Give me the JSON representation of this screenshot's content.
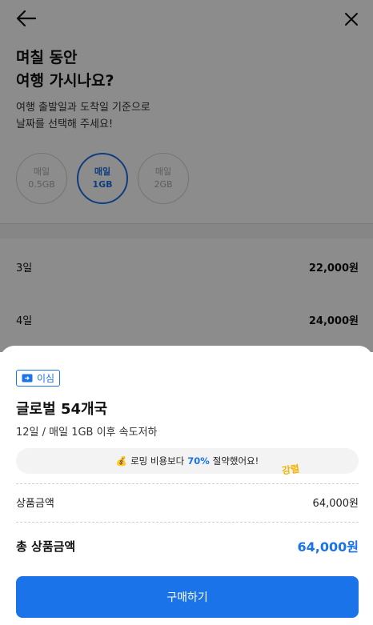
{
  "header": {
    "back_icon": "arrow-left-icon",
    "close_icon": "close-icon"
  },
  "question": {
    "title_line1": "며칠 동안",
    "title_line2": "여행 가시나요?",
    "desc_line1": "여행 출발일과 도착일 기준으로",
    "desc_line2": "날짜를 선택해 주세요!"
  },
  "plans": [
    {
      "line1": "매일",
      "line2": "0.5GB",
      "selected": false
    },
    {
      "line1": "매일",
      "line2": "1GB",
      "selected": true
    },
    {
      "line1": "매일",
      "line2": "2GB",
      "selected": false
    }
  ],
  "days": [
    {
      "label": "3일",
      "price": "22,000원"
    },
    {
      "label": "4일",
      "price": "24,000원"
    }
  ],
  "sheet": {
    "tag_label": "이심",
    "tag_icon": "esim-card-icon",
    "product_name": "글로벌 54개국",
    "product_desc": "12일 / 매일 1GB 이후 속도저하",
    "save_prefix": "로밍 비용보다",
    "save_percent": "70%",
    "save_suffix": "절약했어요!",
    "save_icon": "money-bag-icon",
    "sticker_text": "강렬",
    "subtotal_label": "상품금액",
    "subtotal_value": "64,000원",
    "total_label": "총 상품금액",
    "total_value": "64,000원",
    "buy_label": "구매하기"
  },
  "colors": {
    "accent": "#1a73e8",
    "overlay": "rgba(0,0,0,0.45)"
  }
}
